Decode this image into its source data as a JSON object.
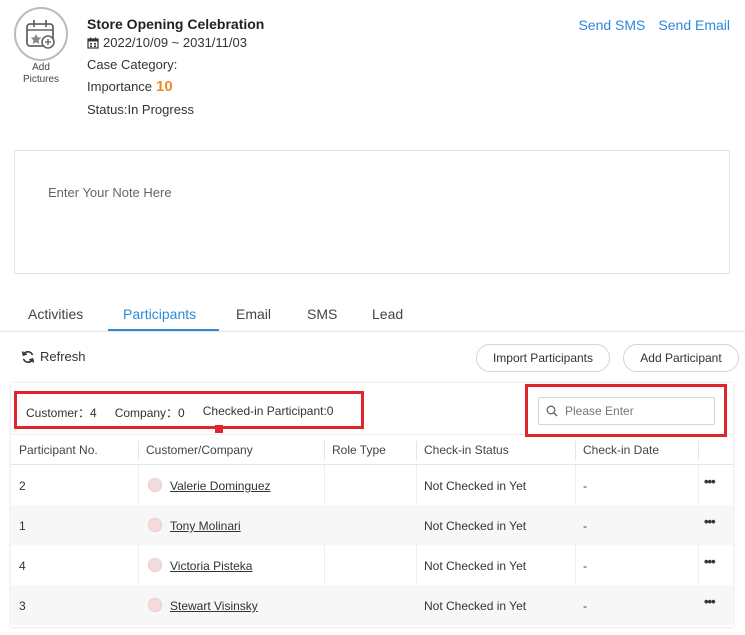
{
  "header": {
    "add_pictures_label": "Add Pictures",
    "title": "Store Opening Celebration",
    "date_range": "2022/10/09 ~ 2031/11/03",
    "case_category": "Case Category:",
    "importance_label": "Importance",
    "importance_value": "10",
    "status": "Status:In Progress",
    "send_sms": "Send SMS",
    "send_email": "Send Email"
  },
  "note": {
    "placeholder": "Enter Your Note Here"
  },
  "tabs": [
    {
      "label": "Activities"
    },
    {
      "label": "Participants",
      "active": true
    },
    {
      "label": "Email"
    },
    {
      "label": "SMS"
    },
    {
      "label": "Lead"
    }
  ],
  "toolbar": {
    "refresh_label": "Refresh",
    "import_label": "Import Participants",
    "add_label": "Add Participant"
  },
  "stats": {
    "customer": "Customer：4",
    "company": "Company：0",
    "checked_in": "Checked-in Participant:0"
  },
  "search": {
    "placeholder": "Please Enter"
  },
  "table": {
    "columns": [
      "Participant No.",
      "Customer/Company",
      "Role Type",
      "Check-in Status",
      "Check-in Date"
    ],
    "rows": [
      {
        "no": "2",
        "name": "Valerie Dominguez",
        "role": "",
        "status": "Not Checked in Yet",
        "date": "-"
      },
      {
        "no": "1",
        "name": "Tony Molinari",
        "role": "",
        "status": "Not Checked in Yet",
        "date": "-"
      },
      {
        "no": "4",
        "name": "Victoria Pisteka",
        "role": "",
        "status": "Not Checked in Yet",
        "date": "-"
      },
      {
        "no": "3",
        "name": "Stewart Visinsky",
        "role": "",
        "status": "Not Checked in Yet",
        "date": "-"
      }
    ],
    "row_action": "•••"
  },
  "colors": {
    "accent": "#2d89d8",
    "importance": "#f08a24",
    "highlight": "#e0242b"
  }
}
